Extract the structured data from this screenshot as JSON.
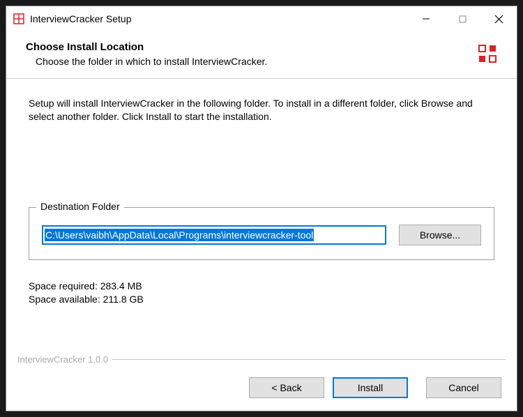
{
  "titlebar": {
    "title": "InterviewCracker Setup"
  },
  "header": {
    "title": "Choose Install Location",
    "subtitle": "Choose the folder in which to install InterviewCracker."
  },
  "body": {
    "intro": "Setup will install InterviewCracker in the following folder. To install in a different folder, click Browse and select another folder. Click Install to start the installation.",
    "destination_legend": "Destination Folder",
    "destination_path": "C:\\Users\\vaibh\\AppData\\Local\\Programs\\interviewcracker-tool",
    "browse_label": "Browse...",
    "space_required": "Space required: 283.4 MB",
    "space_available": "Space available: 211.8 GB"
  },
  "footer": {
    "brand": "InterviewCracker 1.0.0",
    "back_label": "< Back",
    "install_label": "Install",
    "cancel_label": "Cancel"
  }
}
